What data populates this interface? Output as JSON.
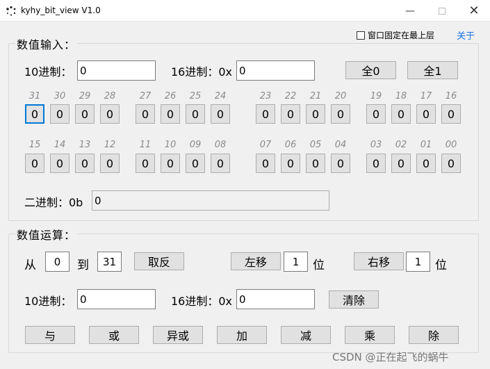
{
  "window": {
    "title": "kyhy_bit_view V1.0",
    "minimize_icon": "minimize-icon",
    "maximize_icon": "maximize-icon",
    "close_icon": "close-icon"
  },
  "topbar": {
    "always_on_top_label": "窗口固定在最上层",
    "always_on_top_checked": false,
    "about_label": "关于",
    "about_color": "#1a73e8"
  },
  "input_group": {
    "title": "数值输入：",
    "dec_label": "10进制：",
    "dec_value": "0",
    "hex_label": "16进制：0x",
    "hex_value": "0",
    "all0_label": "全0",
    "all1_label": "全1",
    "bin_label": "二进制：0b",
    "bin_value": "0",
    "bits_row1": {
      "indices": [
        "31",
        "30",
        "29",
        "28",
        "27",
        "26",
        "25",
        "24",
        "23",
        "22",
        "21",
        "20",
        "19",
        "18",
        "17",
        "16"
      ],
      "values": [
        "0",
        "0",
        "0",
        "0",
        "0",
        "0",
        "0",
        "0",
        "0",
        "0",
        "0",
        "0",
        "0",
        "0",
        "0",
        "0"
      ]
    },
    "bits_row2": {
      "indices": [
        "15",
        "14",
        "13",
        "12",
        "11",
        "10",
        "09",
        "08",
        "07",
        "06",
        "05",
        "04",
        "03",
        "02",
        "01",
        "00"
      ],
      "values": [
        "0",
        "0",
        "0",
        "0",
        "0",
        "0",
        "0",
        "0",
        "0",
        "0",
        "0",
        "0",
        "0",
        "0",
        "0",
        "0"
      ]
    }
  },
  "calc_group": {
    "title": "数值运算：",
    "from_label": "从",
    "from_value": "0",
    "to_label": "到",
    "to_value": "31",
    "invert_label": "取反",
    "shl_label": "左移",
    "shl_value": "1",
    "shl_unit": "位",
    "shr_label": "右移",
    "shr_value": "1",
    "shr_unit": "位",
    "dec_label": "10进制：",
    "dec_value": "0",
    "hex_label": "16进制：0x",
    "hex_value": "0",
    "clear_label": "清除",
    "ops": [
      "与",
      "或",
      "异或",
      "加",
      "减",
      "乘",
      "除"
    ]
  },
  "watermark": "CSDN @正在起飞的蜗牛",
  "colors": {
    "focus": "#0078d7",
    "button_bg": "#e1e1e1",
    "window_bg": "#f0f0f0"
  }
}
